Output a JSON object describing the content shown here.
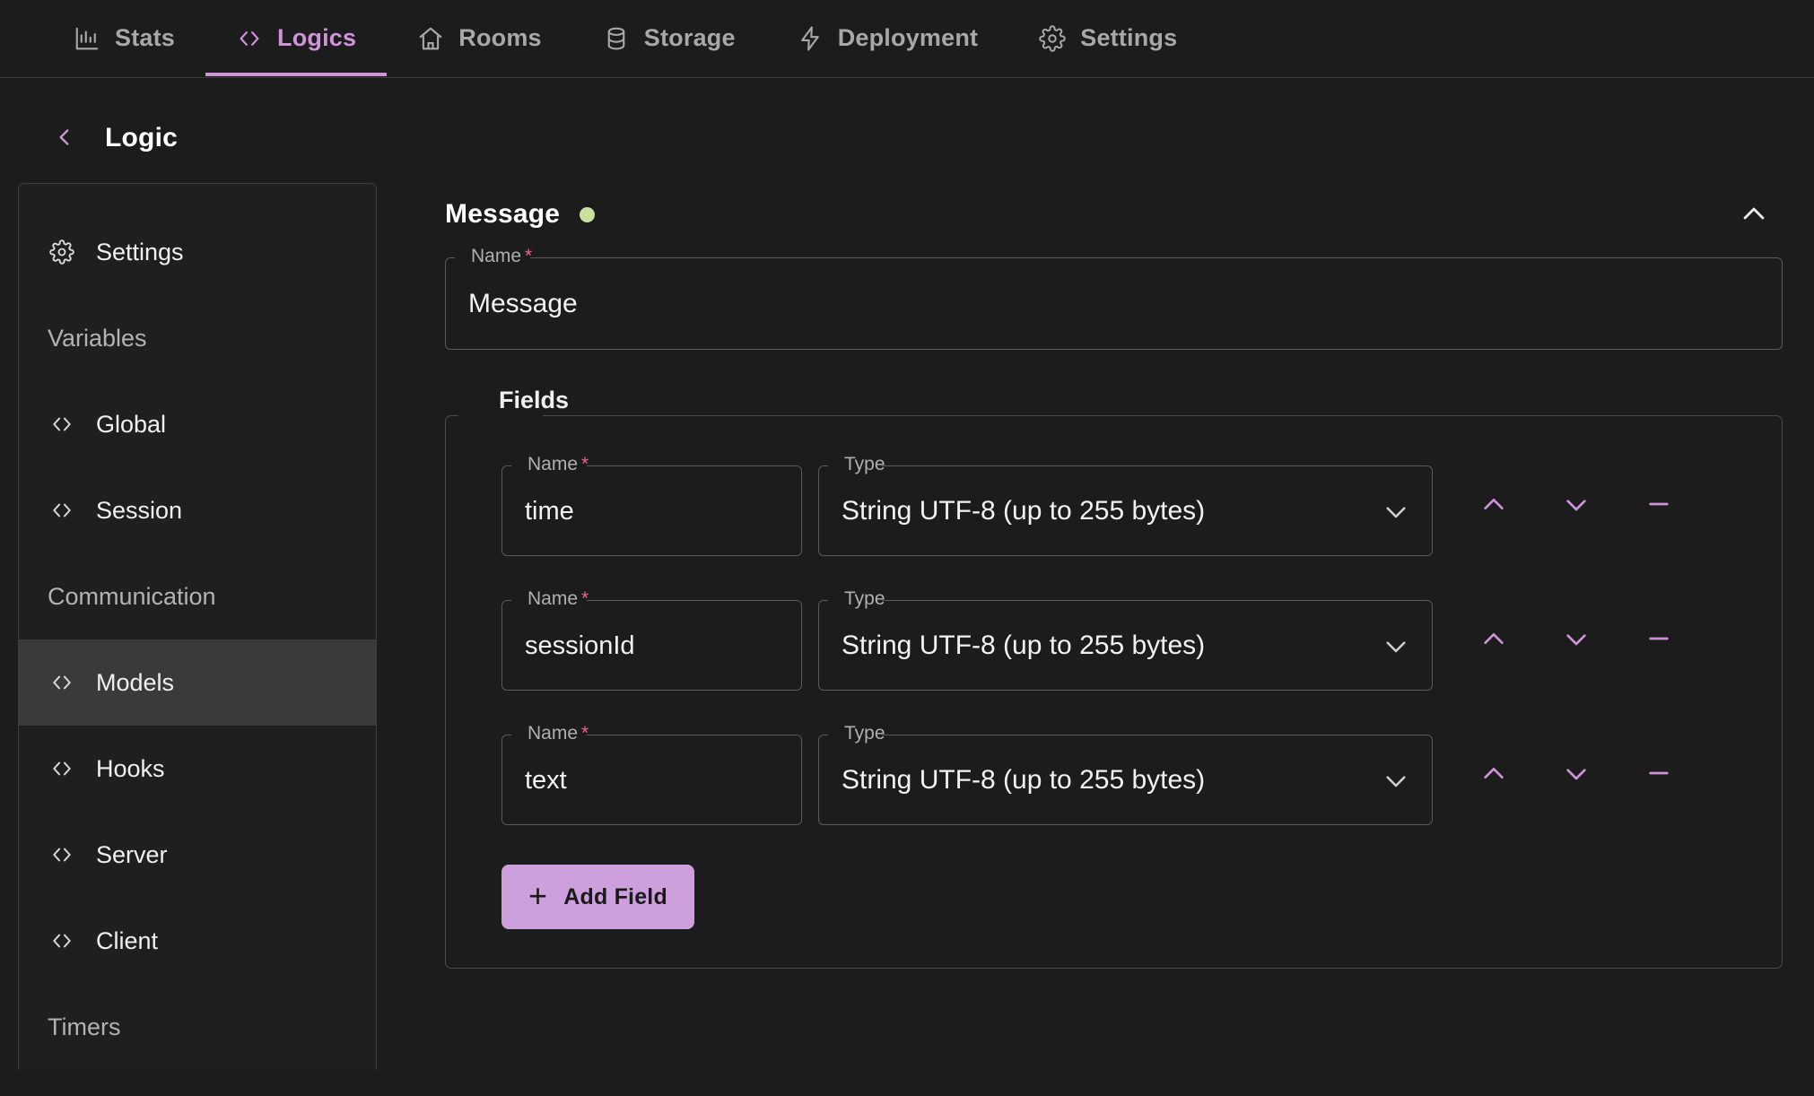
{
  "nav": {
    "tabs": [
      {
        "label": "Stats",
        "icon": "bar-chart-icon",
        "active": false
      },
      {
        "label": "Logics",
        "icon": "code-brackets-icon",
        "active": true
      },
      {
        "label": "Rooms",
        "icon": "home-icon",
        "active": false
      },
      {
        "label": "Storage",
        "icon": "database-icon",
        "active": false
      },
      {
        "label": "Deployment",
        "icon": "lightning-bolt-icon",
        "active": false
      },
      {
        "label": "Settings",
        "icon": "gear-icon",
        "active": false
      }
    ]
  },
  "header": {
    "back_icon": "chevron-left-icon",
    "title": "Logic"
  },
  "sidebar": {
    "items": [
      {
        "label": "Settings",
        "icon": "gear-icon",
        "type": "item",
        "selected": false
      },
      {
        "label": "Variables",
        "icon": "none",
        "type": "group",
        "selected": false
      },
      {
        "label": "Global",
        "icon": "code-brackets-icon",
        "type": "item",
        "selected": false
      },
      {
        "label": "Session",
        "icon": "code-brackets-icon",
        "type": "item",
        "selected": false
      },
      {
        "label": "Communication",
        "icon": "none",
        "type": "group",
        "selected": false
      },
      {
        "label": "Models",
        "icon": "code-brackets-icon",
        "type": "item",
        "selected": true
      },
      {
        "label": "Hooks",
        "icon": "code-brackets-icon",
        "type": "item",
        "selected": false
      },
      {
        "label": "Server",
        "icon": "code-brackets-icon",
        "type": "item",
        "selected": false
      },
      {
        "label": "Client",
        "icon": "code-brackets-icon",
        "type": "item",
        "selected": false
      },
      {
        "label": "Timers",
        "icon": "none",
        "type": "group",
        "selected": false
      }
    ]
  },
  "model_panel": {
    "title": "Message",
    "status_dot_color": "#ccdfa0",
    "collapse_icon": "chevron-up-icon",
    "name_field": {
      "label": "Name",
      "required_marker": "*",
      "value": "Message"
    },
    "fields_group_label": "Fields",
    "field_labels": {
      "name": "Name",
      "type": "Type",
      "required_marker": "*"
    },
    "fields": [
      {
        "name": "time",
        "type": "String UTF-8 (up to 255 bytes)"
      },
      {
        "name": "sessionId",
        "type": "String UTF-8 (up to 255 bytes)"
      },
      {
        "name": "text",
        "type": "String UTF-8 (up to 255 bytes)"
      }
    ],
    "row_actions": {
      "move_up_icon": "chevron-up-icon",
      "move_down_icon": "chevron-down-icon",
      "remove_icon": "minus-icon"
    },
    "add_field": {
      "label": "Add Field",
      "icon": "plus-icon"
    }
  },
  "colors": {
    "accent": "#ce93d8",
    "accent_button": "#ce9fdd",
    "background": "#1c1c1c",
    "panel": "#1f1f1f",
    "selected_row": "#3a3a3a",
    "required_star": "#f06292",
    "status_ok": "#ccdfa0",
    "border": "#5a5a5a",
    "text_primary": "#f0f0f0",
    "text_muted": "#b0b0b0"
  }
}
